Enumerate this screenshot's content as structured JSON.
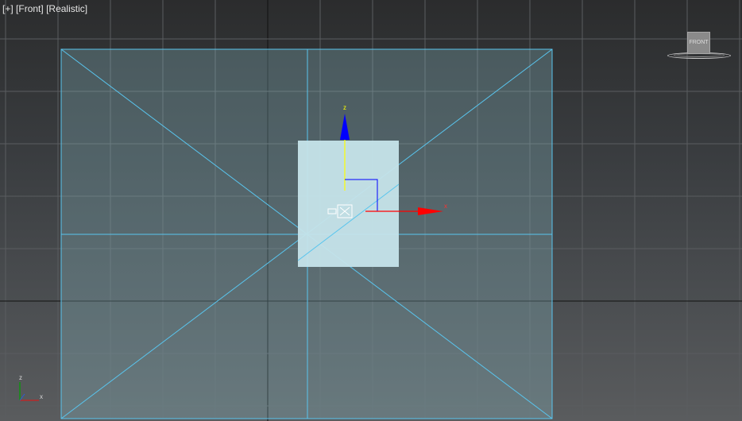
{
  "viewport": {
    "label_parts": [
      "[+]",
      "[Front]",
      "[Realistic]"
    ],
    "shading_mode": "Realistic",
    "view": "Front"
  },
  "nav_cube": {
    "face_label": "FRONT",
    "icon": "viewcube-icon"
  },
  "gizmo": {
    "z_label": "z",
    "x_label": "x",
    "colors": {
      "z": "#0000ff",
      "x": "#ff0000",
      "z_shaft": "#ffff00",
      "center": "#ffffff"
    }
  },
  "axis_tripod": {
    "z_label": "z",
    "x_label": "x",
    "colors": {
      "z": "#00a000",
      "x": "#cc2020"
    }
  },
  "colors": {
    "grid": "#5a5d60",
    "grid_origin": "#111111",
    "selection_wire": "#59c5ee",
    "plane_fill": "#8fc4d2",
    "object_fill": "#c6e4ea"
  }
}
